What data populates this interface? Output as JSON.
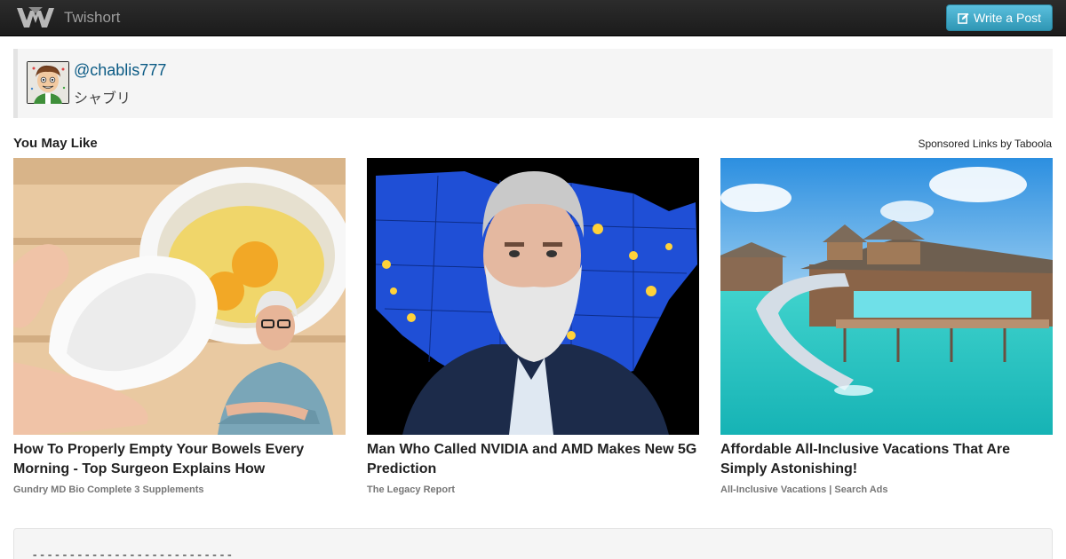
{
  "app": {
    "name": "Twishort",
    "write_button_label": "Write a Post"
  },
  "post": {
    "username": "@chablis777",
    "display_name": "シャブリ"
  },
  "recommendations": {
    "title": "You May Like",
    "sponsored_label": "Sponsored Links by Taboola",
    "items": [
      {
        "title": "How To Properly Empty Your Bowels Every Morning - Top Surgeon Explains How",
        "source": "Gundry MD Bio Complete 3 Supplements"
      },
      {
        "title": "Man Who Called NVIDIA and AMD Makes New 5G Prediction",
        "source": "The Legacy Report"
      },
      {
        "title": "Affordable All-Inclusive Vacations That Are Simply Astonishing!",
        "source": "All-Inclusive Vacations | Search Ads"
      }
    ]
  },
  "bottom": {
    "divider_text": "---------------------------"
  },
  "colors": {
    "navbar": "#1b1b1b",
    "button": "#49afcd",
    "link": "#0a5a84"
  },
  "icons": {
    "logo": "twishort-logo-icon",
    "write": "edit-icon"
  }
}
